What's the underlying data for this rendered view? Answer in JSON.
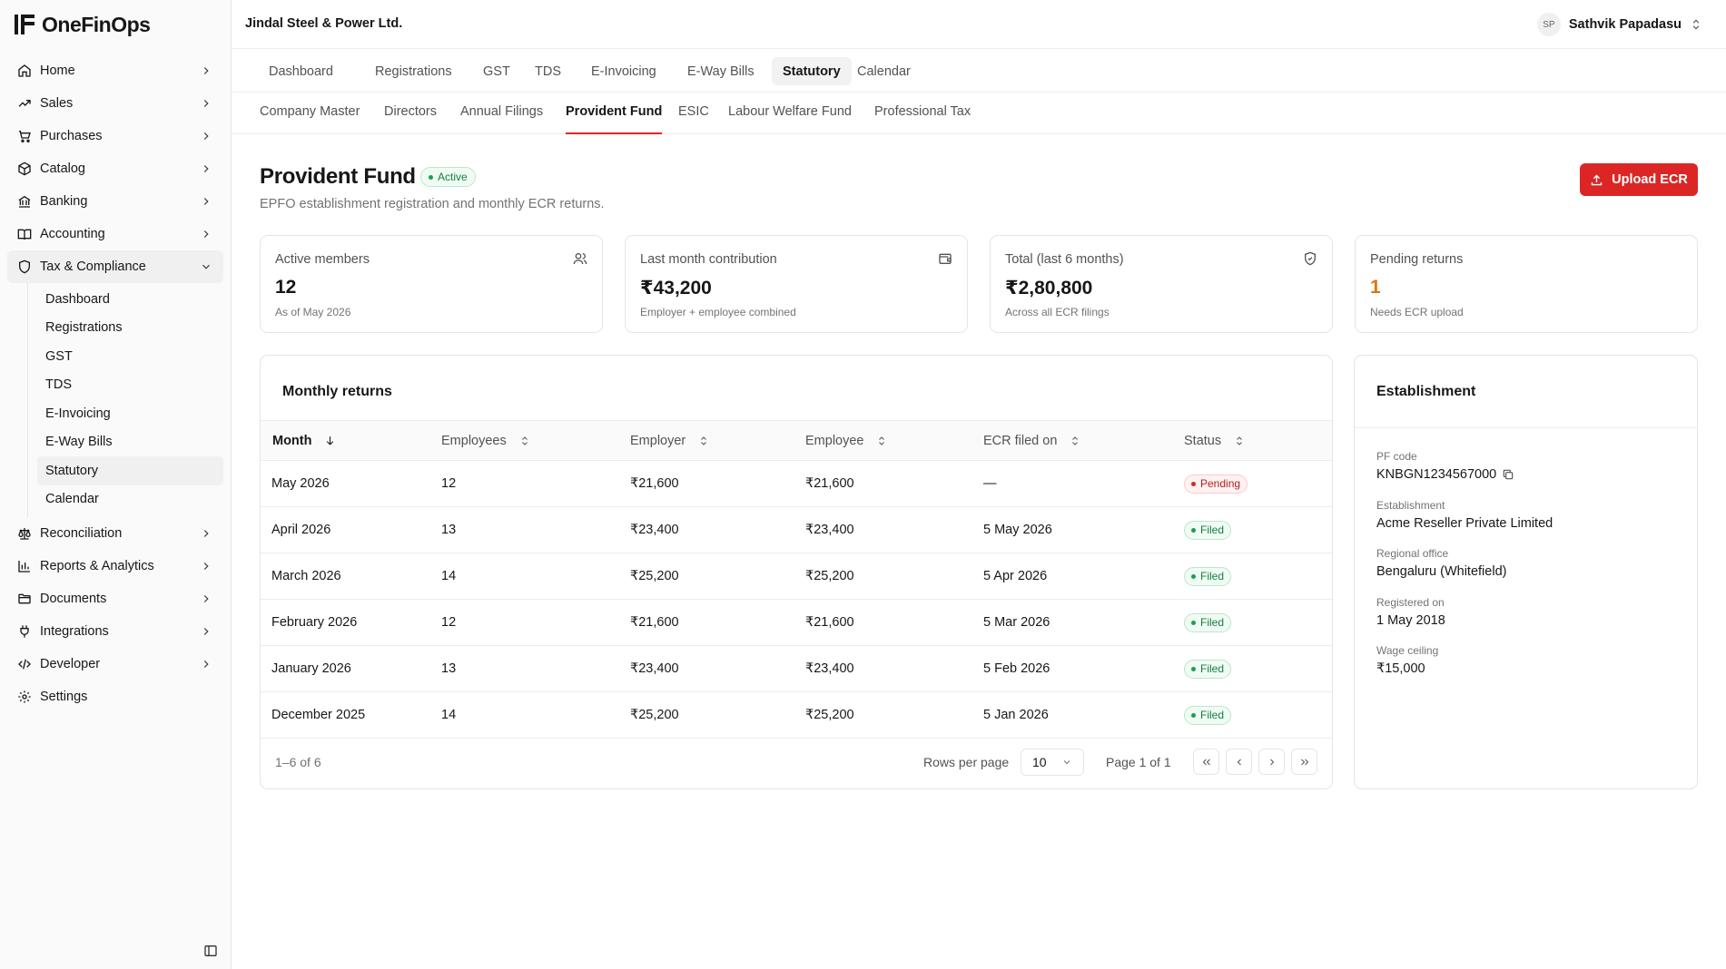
{
  "app": {
    "name": "OneFinOps"
  },
  "sidebar": {
    "items": [
      {
        "label": "Home",
        "icon": "home-icon"
      },
      {
        "label": "Sales",
        "icon": "trend-up-icon"
      },
      {
        "label": "Purchases",
        "icon": "cart-icon"
      },
      {
        "label": "Catalog",
        "icon": "package-icon"
      },
      {
        "label": "Banking",
        "icon": "bank-icon"
      },
      {
        "label": "Accounting",
        "icon": "book-icon"
      },
      {
        "label": "Tax & Compliance",
        "icon": "shield-icon"
      },
      {
        "label": "Reconciliation",
        "icon": "scale-icon"
      },
      {
        "label": "Reports & Analytics",
        "icon": "bar-chart-icon"
      },
      {
        "label": "Documents",
        "icon": "folder-icon"
      },
      {
        "label": "Integrations",
        "icon": "plug-icon"
      },
      {
        "label": "Developer",
        "icon": "code-icon"
      },
      {
        "label": "Settings",
        "icon": "gear-icon"
      }
    ],
    "sub_items": [
      "Dashboard",
      "Registrations",
      "GST",
      "TDS",
      "E-Invoicing",
      "E-Way Bills",
      "Statutory",
      "Calendar"
    ]
  },
  "header": {
    "company": "Jindal Steel & Power Ltd.",
    "user_initials": "SP",
    "user_name": "Sathvik Papadasu"
  },
  "tabs": [
    "Dashboard",
    "Registrations",
    "GST",
    "TDS",
    "E-Invoicing",
    "E-Way Bills",
    "Statutory",
    "Calendar"
  ],
  "subtabs": [
    "Company Master",
    "Directors",
    "Annual Filings",
    "Provident Fund",
    "ESIC",
    "Labour Welfare Fund",
    "Professional Tax"
  ],
  "page": {
    "title": "Provident Fund",
    "status": "Active",
    "subtitle": "EPFO establishment registration and monthly ECR returns.",
    "upload_label": "Upload ECR"
  },
  "stats": [
    {
      "label": "Active members",
      "value": "12",
      "note": "As of May 2026",
      "icon": "users-icon"
    },
    {
      "label": "Last month contribution",
      "value": "₹43,200",
      "note": "Employer + employee combined",
      "icon": "wallet-icon"
    },
    {
      "label": "Total (last 6 months)",
      "value": "₹2,80,800",
      "note": "Across all ECR filings",
      "icon": "shield-check-icon"
    },
    {
      "label": "Pending returns",
      "value": "1",
      "note": "Needs ECR upload",
      "icon": ""
    }
  ],
  "returns": {
    "title": "Monthly returns",
    "columns": [
      "Month",
      "Employees",
      "Employer",
      "Employee",
      "ECR filed on",
      "Status"
    ],
    "rows": [
      {
        "month": "May 2026",
        "employees": "12",
        "employer": "₹21,600",
        "employee": "₹21,600",
        "filed_on": "—",
        "status": "Pending"
      },
      {
        "month": "April 2026",
        "employees": "13",
        "employer": "₹23,400",
        "employee": "₹23,400",
        "filed_on": "5 May 2026",
        "status": "Filed"
      },
      {
        "month": "March 2026",
        "employees": "14",
        "employer": "₹25,200",
        "employee": "₹25,200",
        "filed_on": "5 Apr 2026",
        "status": "Filed"
      },
      {
        "month": "February 2026",
        "employees": "12",
        "employer": "₹21,600",
        "employee": "₹21,600",
        "filed_on": "5 Mar 2026",
        "status": "Filed"
      },
      {
        "month": "January 2026",
        "employees": "13",
        "employer": "₹23,400",
        "employee": "₹23,400",
        "filed_on": "5 Feb 2026",
        "status": "Filed"
      },
      {
        "month": "December 2025",
        "employees": "14",
        "employer": "₹25,200",
        "employee": "₹25,200",
        "filed_on": "5 Jan 2026",
        "status": "Filed"
      }
    ],
    "pager": {
      "count": "1–6 of 6",
      "rows_per_page_label": "Rows per page",
      "rows_per_page": "10",
      "page": "Page 1 of 1"
    }
  },
  "establishment": {
    "title": "Establishment",
    "fields": [
      {
        "label": "PF code",
        "value": "KNBGN1234567000"
      },
      {
        "label": "Establishment",
        "value": "Acme Reseller Private Limited"
      },
      {
        "label": "Regional office",
        "value": "Bengaluru (Whitefield)"
      },
      {
        "label": "Registered on",
        "value": "1 May 2018"
      },
      {
        "label": "Wage ceiling",
        "value": "₹15,000"
      }
    ]
  },
  "colors": {
    "accent": "#dc2626",
    "filed": "#15803d",
    "pending": "#b91c1c",
    "warn": "#d97706"
  }
}
